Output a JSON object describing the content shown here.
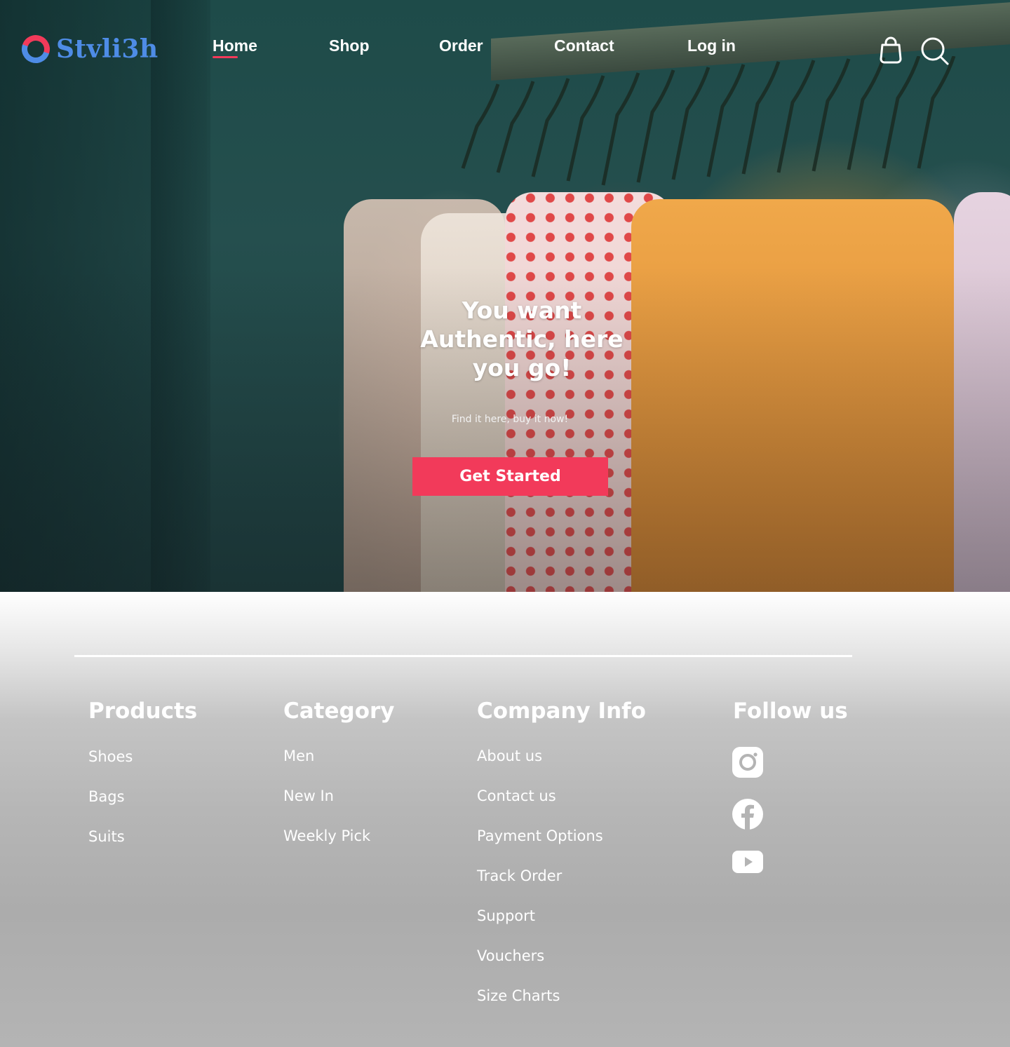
{
  "brand": {
    "name": "Stvli3h"
  },
  "nav": {
    "links": [
      {
        "label": "Home",
        "active": true
      },
      {
        "label": "Shop",
        "active": false
      },
      {
        "label": "Order",
        "active": false
      },
      {
        "label": "Contact",
        "active": false
      },
      {
        "label": "Log in",
        "active": false
      }
    ],
    "icons": [
      "bag-icon",
      "search-icon"
    ]
  },
  "hero": {
    "headline": "You want Authentic, here you go!",
    "subline": "Find it here, buy it now!",
    "cta_label": "Get Started"
  },
  "footer": {
    "columns": [
      {
        "heading": "Products",
        "links": [
          "Shoes",
          "Bags",
          "Suits"
        ]
      },
      {
        "heading": "Category",
        "links": [
          "Men",
          "New In",
          "Weekly Pick"
        ]
      },
      {
        "heading": "Company Info",
        "links": [
          "About us",
          "Contact us",
          "Payment Options",
          "Track Order",
          "Support",
          "Vouchers",
          "Size Charts"
        ]
      },
      {
        "heading": "Follow us",
        "social": [
          "instagram-icon",
          "facebook-icon",
          "youtube-icon"
        ]
      }
    ]
  },
  "colors": {
    "accent": "#f23a5a",
    "brand_blue": "#4e8ce6",
    "hero_bg": "#1e4b49"
  }
}
